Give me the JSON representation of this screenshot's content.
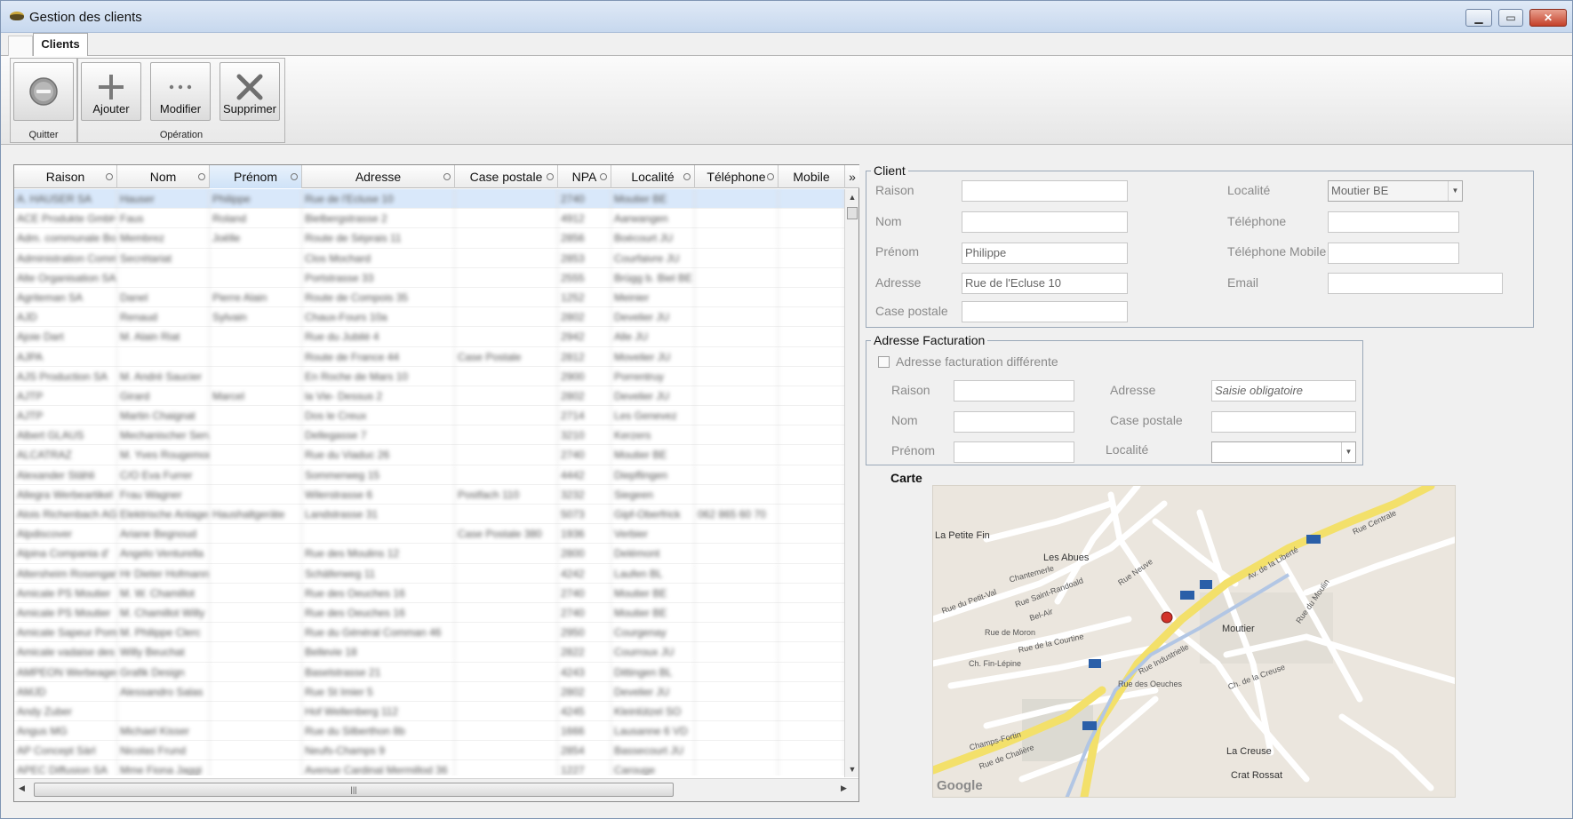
{
  "window": {
    "title": "Gestion des clients",
    "min": "▁",
    "max": "▭",
    "close": "✕"
  },
  "tabs": [
    {
      "label": "Clients",
      "active": true
    }
  ],
  "ribbon": {
    "groups": [
      {
        "caption": "Quitter",
        "buttons": [
          {
            "label": "",
            "icon": "minus-circle-icon"
          }
        ]
      },
      {
        "caption": "Opération",
        "buttons": [
          {
            "label": "Ajouter",
            "icon": "plus-icon"
          },
          {
            "label": "Modifier",
            "icon": "ellipsis-icon"
          },
          {
            "label": "Supprimer",
            "icon": "x-icon"
          }
        ]
      }
    ]
  },
  "grid": {
    "columns": [
      "Raison",
      "Nom",
      "Prénom",
      "Adresse",
      "Case postale",
      "NPA",
      "Localité",
      "Téléphone",
      "Mobile"
    ],
    "more": "»",
    "hscroll_grip": "|||",
    "rows": [
      [
        "A. HAUSER SA",
        "Hauser",
        "Philippe",
        "Rue de l'Ecluse 10",
        "",
        "2740",
        "Moutier BE",
        "",
        ""
      ],
      [
        "ACE Produkte GmbH",
        "Faus",
        "Roland",
        "Biel­bergstrasse 2",
        "",
        "4912",
        "Aarwangen",
        "",
        ""
      ],
      [
        "Adm. communale Bo",
        "Membrez",
        "Joëlle",
        "Route de Séprais 11",
        "",
        "2856",
        "Boécourt JU",
        "",
        ""
      ],
      [
        "Administration Comm",
        "Secrétariat",
        "",
        "Clos Mochard",
        "",
        "2853",
        "Courfaivre JU",
        "",
        ""
      ],
      [
        "Alte Organisation SA",
        "",
        "",
        "Portstrasse 33",
        "",
        "2555",
        "Brügg b. Biel BE",
        "",
        ""
      ],
      [
        "Agriteman SA",
        "Danel",
        "Pierre Alain",
        "Route de Compois 35",
        "",
        "1252",
        "Meinier",
        "",
        ""
      ],
      [
        "AJD",
        "Renaud",
        "Sylvain",
        "Chaux-Fours 10a",
        "",
        "2802",
        "Develier JU",
        "",
        ""
      ],
      [
        "Ajoie Dart",
        "M. Alain Riat",
        "",
        "Rue du Jubilé 4",
        "",
        "2942",
        "Alle JU",
        "",
        ""
      ],
      [
        "AJPA",
        "",
        "",
        "Route de France 44",
        "Case Postale",
        "2812",
        "Movelier JU",
        "",
        ""
      ],
      [
        "AJS Production SA",
        "M. André Saucier",
        "",
        "En Roche de Mars 10",
        "",
        "2900",
        "Porrentruy",
        "",
        ""
      ],
      [
        "AJTP",
        "Girard",
        "Marcel",
        "la Vie- Dessus 2",
        "",
        "2802",
        "Develier JU",
        "",
        ""
      ],
      [
        "AJTP",
        "Martin Chaignat",
        "",
        "Dos le Creux",
        "",
        "2714",
        "Les Genevez",
        "",
        ""
      ],
      [
        "Albert GLAUS",
        "Mechanischer Service",
        "",
        "Dellegasse 7",
        "",
        "3210",
        "Kerzers",
        "",
        ""
      ],
      [
        "ALCATRAZ",
        "M. Yves Rougemont",
        "",
        "Rue du Viaduc 26",
        "",
        "2740",
        "Moutier BE",
        "",
        ""
      ],
      [
        "Alexander Stähli",
        "C/O Eva Furrer",
        "",
        "Sommerweg 15",
        "",
        "4442",
        "Diepflingen",
        "",
        ""
      ],
      [
        "Allegra Werbeartikel",
        "Frau Wagner",
        "",
        "Wilerstrasse 6",
        "Postfach 110",
        "3232",
        "Siegeen",
        "",
        ""
      ],
      [
        "Alois Richenbach AG",
        "Elektrische Anlagen",
        "Haushaltgeräte",
        "Landstrasse 31",
        "",
        "5073",
        "Gipf-Oberfrick",
        "062 865 60 70",
        ""
      ],
      [
        "Alpdiscover",
        "Ariane Begnoud",
        "",
        "",
        "Case Postale 380",
        "1936",
        "Verbier",
        "",
        ""
      ],
      [
        "Alpina Compania d'",
        "Angelo Venturella",
        "",
        "Rue des Moulins 12",
        "",
        "2800",
        "Delémont",
        "",
        ""
      ],
      [
        "Altersheim Rosengarten",
        "Hr Dieter Hofmann",
        "",
        "Schäferweg 11",
        "",
        "4242",
        "Laufen BL",
        "",
        ""
      ],
      [
        "Amicale PS Moutier",
        "M. W. Chamillot",
        "",
        "Rue des Oeuches 16",
        "",
        "2740",
        "Moutier BE",
        "",
        ""
      ],
      [
        "Amicale PS Moutier",
        "M. Chamillot Willy",
        "",
        "Rue des Oeuches 16",
        "",
        "2740",
        "Moutier BE",
        "",
        ""
      ],
      [
        "Amicale Sapeur Pomp",
        "M. Philippe Clerc",
        "",
        "Rue du Général Comman 46",
        "",
        "2950",
        "Courgenay",
        "",
        ""
      ],
      [
        "Amicale vadaise des",
        "Willy Beuchat",
        "",
        "Bellevie 18",
        "",
        "2822",
        "Courroux JU",
        "",
        ""
      ],
      [
        "AMPEON Werbeagentur",
        "Grafik Design",
        "",
        "Baselstrasse 21",
        "",
        "4243",
        "Dittingen BL",
        "",
        ""
      ],
      [
        "AMJD",
        "Alessandro Salas",
        "",
        "Rue St Imier 5",
        "",
        "2802",
        "Develier JU",
        "",
        ""
      ],
      [
        "Andy Zuber",
        "",
        "",
        "Hof Wellenberg 112",
        "",
        "4245",
        "Kleinlützel SO",
        "",
        ""
      ],
      [
        "Angus MG",
        "Michael Kisser",
        "",
        "Rue du Silberthon 8b",
        "",
        "1666",
        "Lausanne 6 VD",
        "",
        ""
      ],
      [
        "AP Concept Sàrl",
        "Nicolas Frund",
        "",
        "Neufs-Champs 9",
        "",
        "2854",
        "Bassecourt JU",
        "",
        ""
      ],
      [
        "APEC Diffusion SA",
        "Mme Fiona Jaggi",
        "",
        "Avenue Cardinal Mermillod 36",
        "",
        "1227",
        "Carouge",
        "",
        ""
      ]
    ]
  },
  "client": {
    "legend": "Client",
    "raison_label": "Raison",
    "raison_value": "",
    "nom_label": "Nom",
    "nom_value": "",
    "prenom_label": "Prénom",
    "prenom_value": "Philippe",
    "adresse_label": "Adresse",
    "adresse_value": "Rue de l'Ecluse 10",
    "case_label": "Case postale",
    "case_value": "",
    "localite_label": "Localité",
    "localite_value": "Moutier  BE",
    "tel_label": "Téléphone",
    "tel_value": "",
    "mobile_label": "Téléphone Mobile",
    "mobile_value": "",
    "email_label": "Email",
    "email_value": ""
  },
  "billing": {
    "legend": "Adresse Facturation",
    "different_label": "Adresse facturation différente",
    "raison_label": "Raison",
    "raison_value": "",
    "nom_label": "Nom",
    "nom_value": "",
    "prenom_label": "Prénom",
    "prenom_value": "",
    "adresse_label": "Adresse",
    "adresse_value": "Saisie obligatoire",
    "case_label": "Case postale",
    "case_value": "",
    "localite_label": "Localité",
    "localite_value": ""
  },
  "map": {
    "title": "Carte",
    "brand": "Google",
    "labels": [
      "La Petite Fin",
      "Les Abues",
      "Moutier",
      "La Creuse",
      "Crat Rossat",
      "Rue Industrielle",
      "Av. de la Liberté",
      "Rue Centrale",
      "Rue de Chalière",
      "Rue Neuve",
      "Rue du Moulin",
      "Rue de Moron",
      "Rue des Oeuches",
      "Ch. de la Creuse",
      "Rue Saint-Randoald",
      "Chantemerle",
      "Bel-Air",
      "Champs-Fortin",
      "Ch. Fin-Lépine",
      "Rue de la Courtine",
      "Rue du Petit-Val"
    ]
  }
}
